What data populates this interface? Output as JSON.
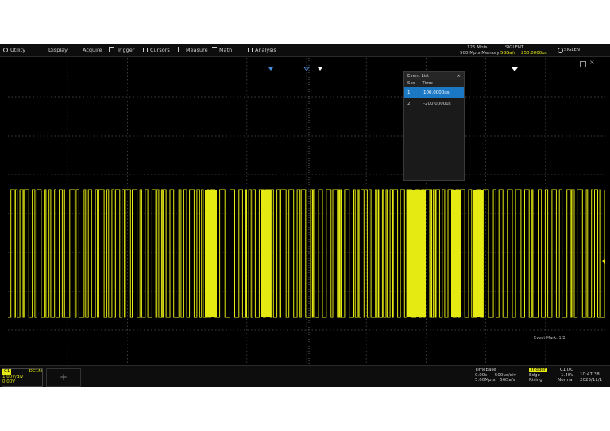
{
  "menu": [
    {
      "name": "utility",
      "label": "Utility"
    },
    {
      "name": "display",
      "label": "Display"
    },
    {
      "name": "acquire",
      "label": "Acquire"
    },
    {
      "name": "trigger",
      "label": "Trigger"
    },
    {
      "name": "cursors",
      "label": "Cursors"
    },
    {
      "name": "measure",
      "label": "Measure"
    },
    {
      "name": "math",
      "label": "Math"
    },
    {
      "name": "analysis",
      "label": "Analysis"
    }
  ],
  "status": {
    "sample_rate_line1": "125 Mpts",
    "memory_line2": "500 Mpts Memory",
    "rate_value": "5GSa/s",
    "mode": "SIGLENT",
    "mode_value": "250.0000us",
    "brand": "SIGLENT"
  },
  "eventlist": {
    "title": "Event List",
    "col1": "Seq",
    "col2": "Time",
    "rows": [
      {
        "idx": "1",
        "time": "100.0000us"
      },
      {
        "idx": "2",
        "time": "-200.0000us"
      }
    ]
  },
  "history_label": "Event Mark: 1/2",
  "bottom": {
    "ch1": "C1",
    "ch1_scale": "DC1M",
    "ch1_v1": "1.00V/div",
    "ch1_v2": "0.00V",
    "timebase_title": "Timebase",
    "timebase_v1": "0.00s",
    "timebase_v2": "500us/div",
    "timebase_v3": "5.00Mpts",
    "timebase_v4": "5GSa/s",
    "trigger_title": "Trigger",
    "trigger_v1": "C1 DC",
    "trigger_v2": "Edge",
    "trigger_v3": "Rising",
    "trigger_v4": "1.40V",
    "trigger_v5": "Normal",
    "clock": "10:47:38",
    "date": "2023/11/1"
  },
  "colors": {
    "trace": "#e6ea13",
    "grid": "#5a5a5a",
    "accent": "#1b78c4"
  }
}
